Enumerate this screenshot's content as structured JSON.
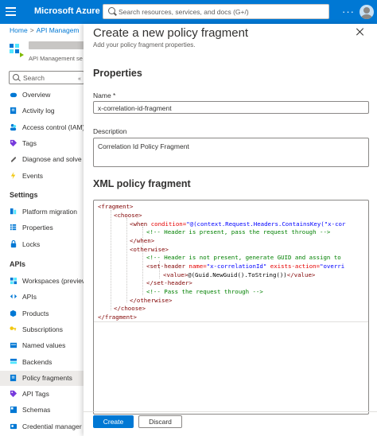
{
  "topbar": {
    "brand": "Microsoft Azure",
    "search_placeholder": "Search resources, services, and docs (G+/)",
    "more": "···"
  },
  "breadcrumb": {
    "home": "Home",
    "sep": ">",
    "current": "API Managem"
  },
  "service": {
    "subtitle": "API Management se"
  },
  "left_search": {
    "placeholder": "Search"
  },
  "nav": {
    "items_top": [
      {
        "label": "Overview",
        "icon": "cloud-icon"
      },
      {
        "label": "Activity log",
        "icon": "log-icon"
      },
      {
        "label": "Access control (IAM)",
        "icon": "people-icon"
      },
      {
        "label": "Tags",
        "icon": "tag-icon"
      },
      {
        "label": "Diagnose and solve p",
        "icon": "wrench-icon"
      },
      {
        "label": "Events",
        "icon": "lightning-icon"
      }
    ],
    "settings_header": "Settings",
    "items_settings": [
      {
        "label": "Platform migration",
        "icon": "migration-icon"
      },
      {
        "label": "Properties",
        "icon": "properties-icon"
      },
      {
        "label": "Locks",
        "icon": "lock-icon"
      }
    ],
    "apis_header": "APIs",
    "items_apis": [
      {
        "label": "Workspaces (preview",
        "icon": "workspaces-icon"
      },
      {
        "label": "APIs",
        "icon": "api-icon"
      },
      {
        "label": "Products",
        "icon": "products-icon"
      },
      {
        "label": "Subscriptions",
        "icon": "key-icon"
      },
      {
        "label": "Named values",
        "icon": "named-values-icon"
      },
      {
        "label": "Backends",
        "icon": "backends-icon"
      },
      {
        "label": "Policy fragments",
        "icon": "policy-icon",
        "active": true
      },
      {
        "label": "API Tags",
        "icon": "tag-icon"
      },
      {
        "label": "Schemas",
        "icon": "schema-icon"
      },
      {
        "label": "Credential manager",
        "icon": "credential-icon"
      }
    ]
  },
  "panel": {
    "title": "Create a new policy fragment",
    "subtitle": "Add your policy fragment properties.",
    "properties_header": "Properties",
    "name_label": "Name *",
    "name_value": "x-correlation-id-fragment",
    "description_label": "Description",
    "description_value": "Correlation Id Policy Fragment",
    "xml_header": "XML policy fragment",
    "create_label": "Create",
    "discard_label": "Discard"
  },
  "xml": {
    "l1": "<fragment>",
    "l2": "<choose>",
    "l3_tag": "<when ",
    "l3_attr": "condition=",
    "l3_val": "\"@(context.Request.Headers.ContainsKey(\"x-cor",
    "l4": "<!-- Header is present, pass the request through -->",
    "l5": "</when>",
    "l6": "<otherwise>",
    "l7": "<!-- Header is not present, generate GUID and assign to",
    "l8_tag": "<set-header ",
    "l8_attr1": "name=",
    "l8_val1": "\"x-correlationId\"",
    "l8_attr2": " exists-action=",
    "l8_val2": "\"overri",
    "l9_tag1": "<value>",
    "l9_text": "@(Guid.NewGuid().ToString())",
    "l9_tag2": "</value>",
    "l10": "</set-header>",
    "l11": "<!-- Pass the request through -->",
    "l12": "</otherwise>",
    "l13": "</choose>",
    "l14": "</fragment>"
  }
}
